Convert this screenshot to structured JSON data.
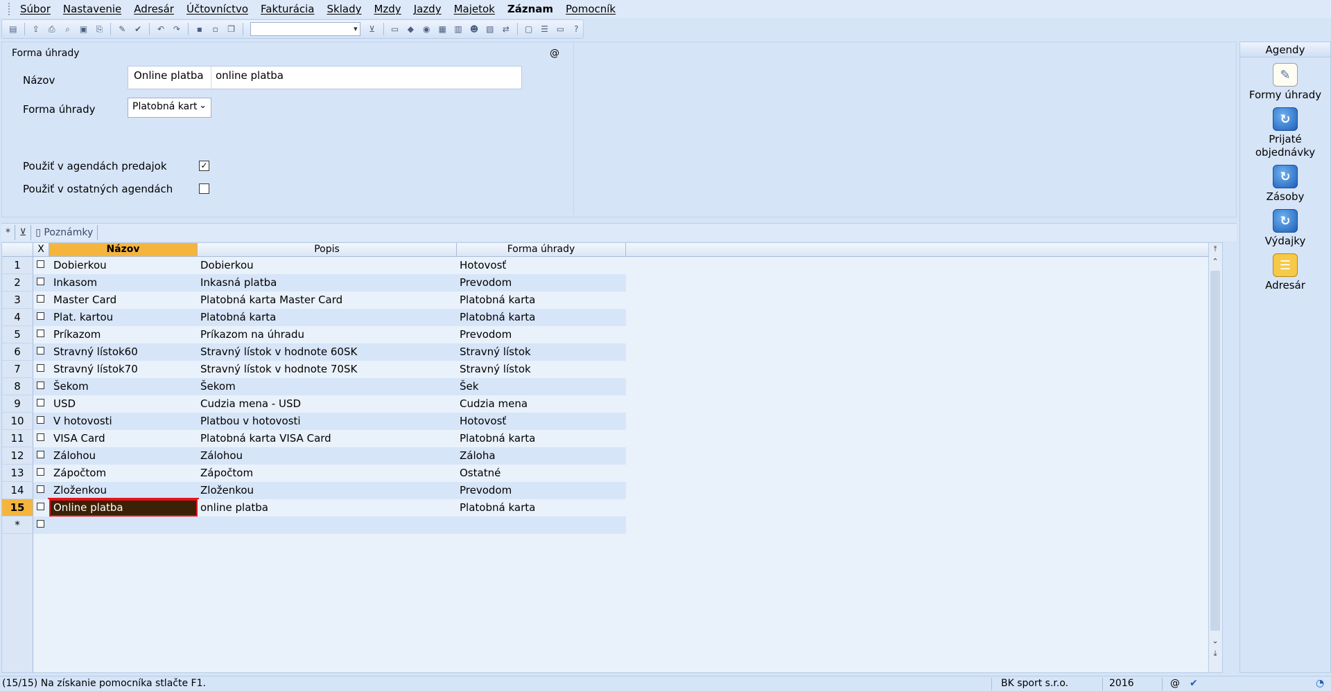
{
  "menu": [
    "Súbor",
    "Nastavenie",
    "Adresár",
    "Účtovníctvo",
    "Fakturácia",
    "Sklady",
    "Mzdy",
    "Jazdy",
    "Majetok",
    "Záznam",
    "Pomocník"
  ],
  "form": {
    "title": "Forma úhrady",
    "at_symbol": "@",
    "name_label": "Názov",
    "name_value": "Online platba",
    "name_desc": "online platba",
    "payment_form_label": "Forma úhrady",
    "payment_form_value": "Platobná kart",
    "use_sales_label": "Použiť v agendách predajok",
    "use_sales_checked": "✓",
    "use_other_label": "Použiť v ostatných agendách"
  },
  "tabs": {
    "star": "*",
    "notes": "Poznámky"
  },
  "grid": {
    "columns": [
      "X",
      "Názov",
      "Popis",
      "Forma úhrady"
    ],
    "rows": [
      {
        "n": "1",
        "nazov": "Dobierkou",
        "popis": "Dobierkou",
        "forma": "Hotovosť"
      },
      {
        "n": "2",
        "nazov": "Inkasom",
        "popis": "Inkasná platba",
        "forma": "Prevodom"
      },
      {
        "n": "3",
        "nazov": "Master Card",
        "popis": "Platobná karta Master Card",
        "forma": "Platobná karta"
      },
      {
        "n": "4",
        "nazov": "Plat. kartou",
        "popis": "Platobná karta",
        "forma": "Platobná karta"
      },
      {
        "n": "5",
        "nazov": "Príkazom",
        "popis": "Príkazom na úhradu",
        "forma": "Prevodom"
      },
      {
        "n": "6",
        "nazov": "Stravný lístok60",
        "popis": "Stravný lístok v hodnote 60SK",
        "forma": "Stravný lístok"
      },
      {
        "n": "7",
        "nazov": "Stravný lístok70",
        "popis": "Stravný lístok v hodnote 70SK",
        "forma": "Stravný lístok"
      },
      {
        "n": "8",
        "nazov": "Šekom",
        "popis": "Šekom",
        "forma": "Šek"
      },
      {
        "n": "9",
        "nazov": "USD",
        "popis": "Cudzia mena - USD",
        "forma": "Cudzia mena"
      },
      {
        "n": "10",
        "nazov": "V hotovosti",
        "popis": "Platbou v hotovosti",
        "forma": "Hotovosť"
      },
      {
        "n": "11",
        "nazov": "VISA Card",
        "popis": "Platobná karta VISA Card",
        "forma": "Platobná karta"
      },
      {
        "n": "12",
        "nazov": "Zálohou",
        "popis": "Zálohou",
        "forma": "Záloha"
      },
      {
        "n": "13",
        "nazov": "Zápočtom",
        "popis": "Zápočtom",
        "forma": "Ostatné"
      },
      {
        "n": "14",
        "nazov": "Zloženkou",
        "popis": "Zloženkou",
        "forma": "Prevodom"
      },
      {
        "n": "15",
        "nazov": "Online platba",
        "popis": "online platba",
        "forma": "Platobná karta"
      },
      {
        "n": "*",
        "nazov": "",
        "popis": "",
        "forma": ""
      }
    ]
  },
  "agendy": {
    "title": "Agendy",
    "items": [
      {
        "label1": "Formy úhrady",
        "label2": "",
        "icon": "doc-icon"
      },
      {
        "label1": "Prijaté",
        "label2": "objednávky",
        "icon": "blue-agenda-icon"
      },
      {
        "label1": "Zásoby",
        "label2": "",
        "icon": "blue-agenda-icon"
      },
      {
        "label1": "Výdajky",
        "label2": "",
        "icon": "blue-agenda-icon"
      },
      {
        "label1": "Adresár",
        "label2": "",
        "icon": "address-book-icon"
      }
    ]
  },
  "status": {
    "help_text": "(15/15) Na získanie pomocníka stlačte F1.",
    "company": "BK sport  s.r.o.",
    "year": "2016",
    "at": "@"
  }
}
